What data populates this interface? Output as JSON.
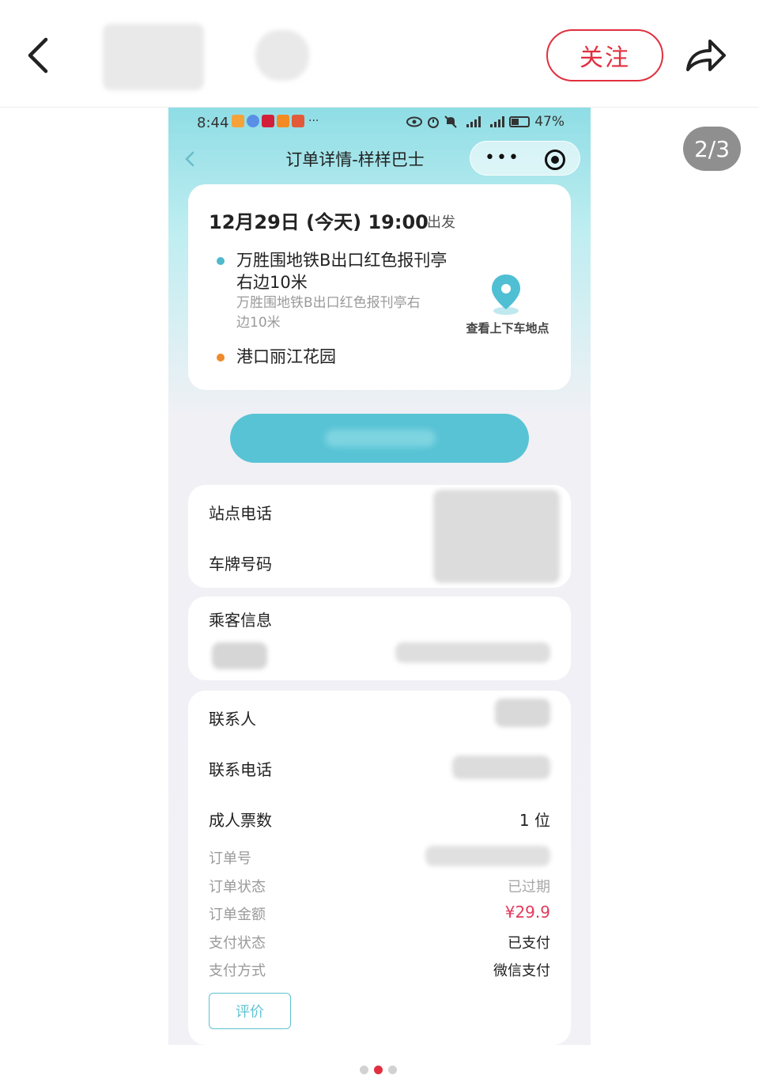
{
  "header": {
    "follow_label": "关注",
    "page_counter": "2/3",
    "carousel": {
      "total": 3,
      "active_index": 1
    }
  },
  "phone": {
    "status": {
      "time": "8:44",
      "ellipsis": "···",
      "battery": "47%"
    },
    "nav": {
      "title": "订单详情-样样巴士",
      "more_glyph": "•••"
    },
    "trip": {
      "date_time": "12月29日 (今天) 19:00",
      "depart_label": "出发",
      "pickup": {
        "name_line1": "万胜围地铁B出口红色报刊亭",
        "name_line2": "右边10米",
        "detail_line1": "万胜围地铁B出口红色报刊亭右",
        "detail_line2": "边10米",
        "dot_color": "#4fb8cc"
      },
      "dropoff": {
        "name": "港口丽江花园",
        "dot_color": "#f08a2c"
      },
      "map_link": "查看上下车地点"
    },
    "station": {
      "phone_label": "站点电话",
      "plate_label": "车牌号码"
    },
    "passenger": {
      "title": "乘客信息"
    },
    "contact": {
      "name_label": "联系人",
      "phone_label": "联系电话",
      "adult_tickets_label": "成人票数",
      "adult_tickets_value": "1 位",
      "order_no_label": "订单号",
      "order_status_label": "订单状态",
      "order_status_value": "已过期",
      "order_amount_label": "订单金额",
      "order_amount_value": "¥29.9",
      "pay_status_label": "支付状态",
      "pay_status_value": "已支付",
      "pay_method_label": "支付方式",
      "pay_method_value": "微信支付",
      "review_label": "评价"
    },
    "colors": {
      "accent": "#58c3d5",
      "price": "#e23a5a",
      "follow": "#e0303f"
    }
  }
}
